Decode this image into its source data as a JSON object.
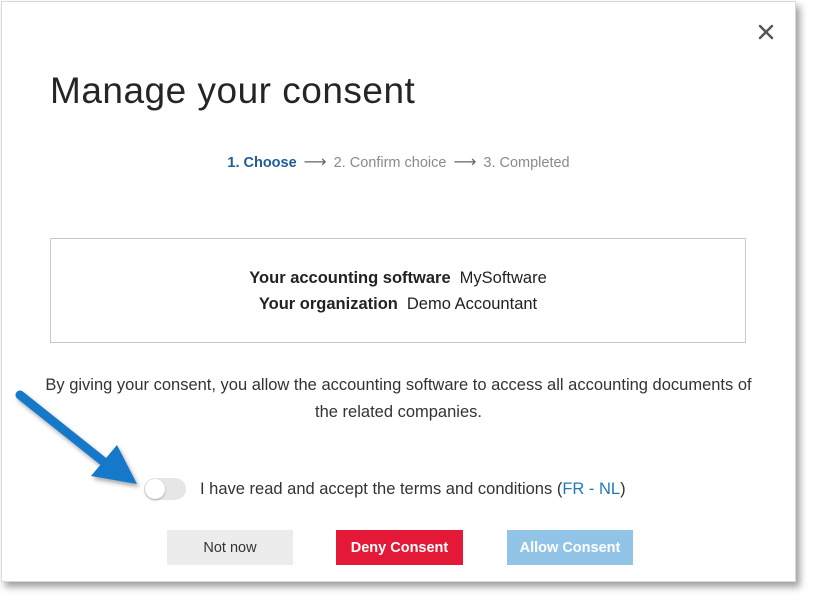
{
  "dialog": {
    "title": "Manage your consent",
    "close_icon": "close-icon"
  },
  "steps": {
    "step1": "1. Choose",
    "step2": "2. Confirm choice",
    "step3": "3. Completed",
    "arrow": "⟶",
    "active_color": "#1d5d99"
  },
  "info": {
    "software_label": "Your accounting software",
    "software_value": "MySoftware",
    "org_label": "Your organization",
    "org_value": "Demo Accountant"
  },
  "description": "By giving your consent, you allow the accounting software to access all accounting documents of the related companies.",
  "terms": {
    "text": "I have read and accept the terms and conditions",
    "open_paren": "(",
    "fr_link": "FR",
    "separator": " - ",
    "nl_link": "NL",
    "close_paren": ")",
    "toggle_state": "off"
  },
  "buttons": {
    "not_now": "Not now",
    "deny": "Deny Consent",
    "allow": "Allow Consent"
  },
  "colors": {
    "deny": "#e31937",
    "allow_disabled": "#91c4e7",
    "link": "#1f7ab8",
    "pointer_arrow": "#1978c8"
  },
  "annotation": {
    "icon": "pointer-arrow-icon"
  }
}
